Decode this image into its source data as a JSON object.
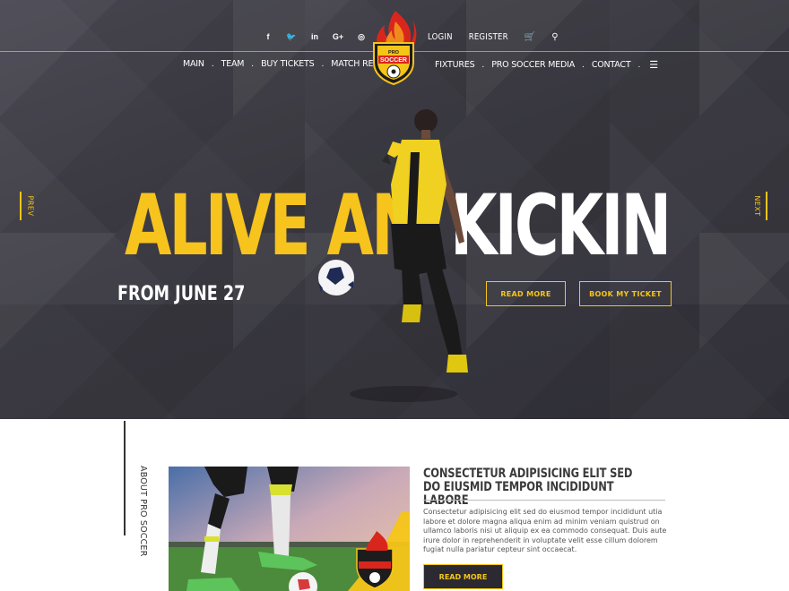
{
  "social_icons": [
    "facebook-icon",
    "twitter-icon",
    "linkedin-icon",
    "google-plus-icon",
    "dribbble-icon"
  ],
  "social_glyphs": [
    "f",
    "🐦",
    "in",
    "G+",
    "◎"
  ],
  "top_links": {
    "login": "LOGIN",
    "register": "REGISTER"
  },
  "nav_left": [
    "MAIN",
    "TEAM",
    "BUY TICKETS",
    "MATCH RESULTS"
  ],
  "nav_right": [
    "FIXTURES",
    "PRO SOCCER MEDIA",
    "CONTACT"
  ],
  "logo": {
    "top_text": "PRO",
    "bottom_text": "SOCCER"
  },
  "hero": {
    "prev_label": "PREV",
    "next_label": "NEXT",
    "headline_yellow": "ALIVE AN",
    "headline_white": "KICKIN",
    "subheadline": "FROM JUNE 27",
    "read_more": "READ MORE",
    "book_ticket": "BOOK MY TICKET"
  },
  "about": {
    "side_label": "ABOUT PRO SOCCER",
    "title": "CONSECTETUR ADIPISICING ELIT SED DO EIUSMID TEMPOR INCIDIDUNT LABORE",
    "body": "Consectetur adipisicing elit sed do eiusmod tempor incididunt utia labore et dolore magna aliqua enim ad minim veniam quistrud on ullamco laboris nisi ut aliquip ex ea commodo consequat. Duis aute irure dolor in reprehenderit in voluptate velit esse cillum dolorem fugiat nulla pariatur cepteur sint occaecat.",
    "read_more": "READ MORE"
  },
  "colors": {
    "accent": "#f5c518",
    "hero_bg": "#3c3b43",
    "dark_button": "#2b2a33"
  }
}
